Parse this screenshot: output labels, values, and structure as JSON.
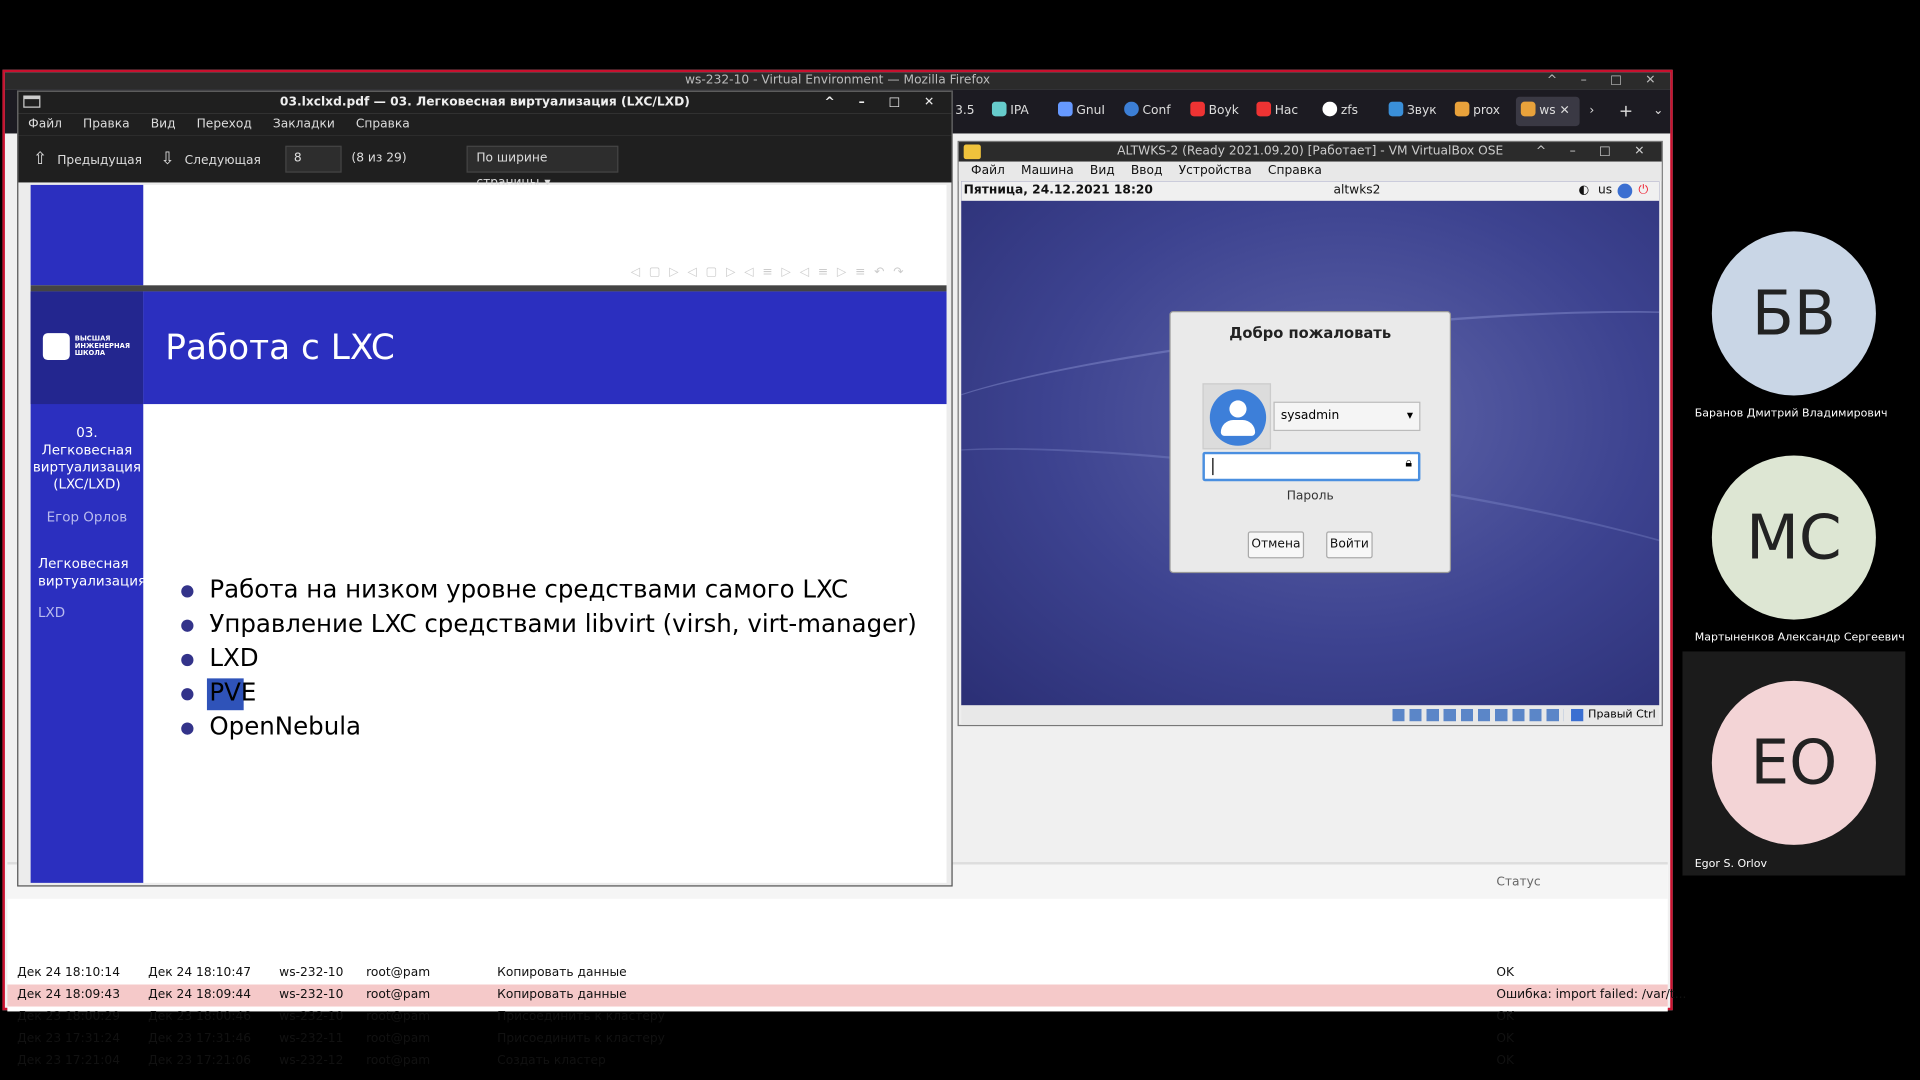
{
  "firefox": {
    "window_title": "ws-232-10 - Virtual Environment — Mozilla Firefox",
    "tabs": [
      {
        "label": "3.5",
        "color": "#888"
      },
      {
        "label": "IPA",
        "color": "#6cc"
      },
      {
        "label": "GnuI",
        "color": "#69f"
      },
      {
        "label": "Conf",
        "color": "#3c7fd6"
      },
      {
        "label": "Boyk",
        "color": "#e33"
      },
      {
        "label": "Нас",
        "color": "#e33"
      },
      {
        "label": "zfs",
        "color": "#fff"
      },
      {
        "label": "Звук",
        "color": "#3a8fd8"
      },
      {
        "label": "prox",
        "color": "#e9a23b"
      },
      {
        "label": "ws",
        "color": "#e9a23b"
      }
    ]
  },
  "task_log": {
    "status_header": "Статус",
    "rows": [
      {
        "start": "Дек 24 18:10:14",
        "end": "Дек 24 18:10:47",
        "node": "ws-232-10",
        "user": "root@pam",
        "desc": "Копировать данные",
        "status": "OK",
        "error": false
      },
      {
        "start": "Дек 24 18:09:43",
        "end": "Дек 24 18:09:44",
        "node": "ws-232-10",
        "user": "root@pam",
        "desc": "Копировать данные",
        "status": "Ошибка: import failed: /var/t...",
        "error": true
      },
      {
        "start": "Дек 23 18:00:29",
        "end": "Дек 23 18:00:46",
        "node": "ws-232-10",
        "user": "root@pam",
        "desc": "Присоединить к кластеру",
        "status": "OK",
        "error": false
      },
      {
        "start": "Дек 23 17:31:24",
        "end": "Дек 23 17:31:46",
        "node": "ws-232-11",
        "user": "root@pam",
        "desc": "Присоединить к кластеру",
        "status": "OK",
        "error": false
      },
      {
        "start": "Дек 23 17:21:04",
        "end": "Дек 23 17:21:06",
        "node": "ws-232-12",
        "user": "root@pam",
        "desc": "Создать кластер",
        "status": "OK",
        "error": false
      }
    ]
  },
  "okular": {
    "title": "03.lxclxd.pdf — 03. Легковесная виртуализация (LXC/LXD)",
    "menu": [
      "Файл",
      "Правка",
      "Вид",
      "Переход",
      "Закладки",
      "Справка"
    ],
    "prev_label": "Предыдущая",
    "next_label": "Следующая",
    "page_input": "8",
    "page_count": "(8 из 29)",
    "zoom": "По ширине страницы"
  },
  "slide": {
    "title": "Работа с LXC",
    "logo_text": "ВЫСШАЯ ИНЖЕНЕРНАЯ ШКОЛА",
    "section": "03. Легковесная виртуализация (LXC/LXD)",
    "author": "Егор Орлов",
    "nav_current": "Легковесная виртуализация",
    "nav_next": "LXD",
    "bullets": [
      "Работа на низком уровне средствами самого LXC",
      "Управление LXC средствами libvirt (virsh, virt-manager)",
      "LXD",
      "PVE",
      "OpenNebula"
    ],
    "selected_text": "PV"
  },
  "virtualbox": {
    "title": "ALTWKS-2 (Ready 2021.09.20) [Работает] - VM VirtualBox OSE",
    "menu": [
      "Файл",
      "Машина",
      "Вид",
      "Ввод",
      "Устройства",
      "Справка"
    ],
    "datetime": "Пятница, 24.12.2021 18:20",
    "hostname": "altwks2",
    "keyboard": "us",
    "host_key": "Правый Ctrl",
    "login": {
      "heading": "Добро пожаловать",
      "user": "sysadmin",
      "password_label": "Пароль",
      "cancel": "Отмена",
      "login": "Войти"
    }
  },
  "participants": [
    {
      "initials": "БВ",
      "name": "Баранов Дмитрий Владимирович",
      "color": "#c9d6e6"
    },
    {
      "initials": "МС",
      "name": "Мартыненков Александр Сергеевич",
      "color": "#dde6d3"
    },
    {
      "initials": "ЕО",
      "name": "Egor S. Orlov",
      "color": "#f3d4d6"
    }
  ]
}
